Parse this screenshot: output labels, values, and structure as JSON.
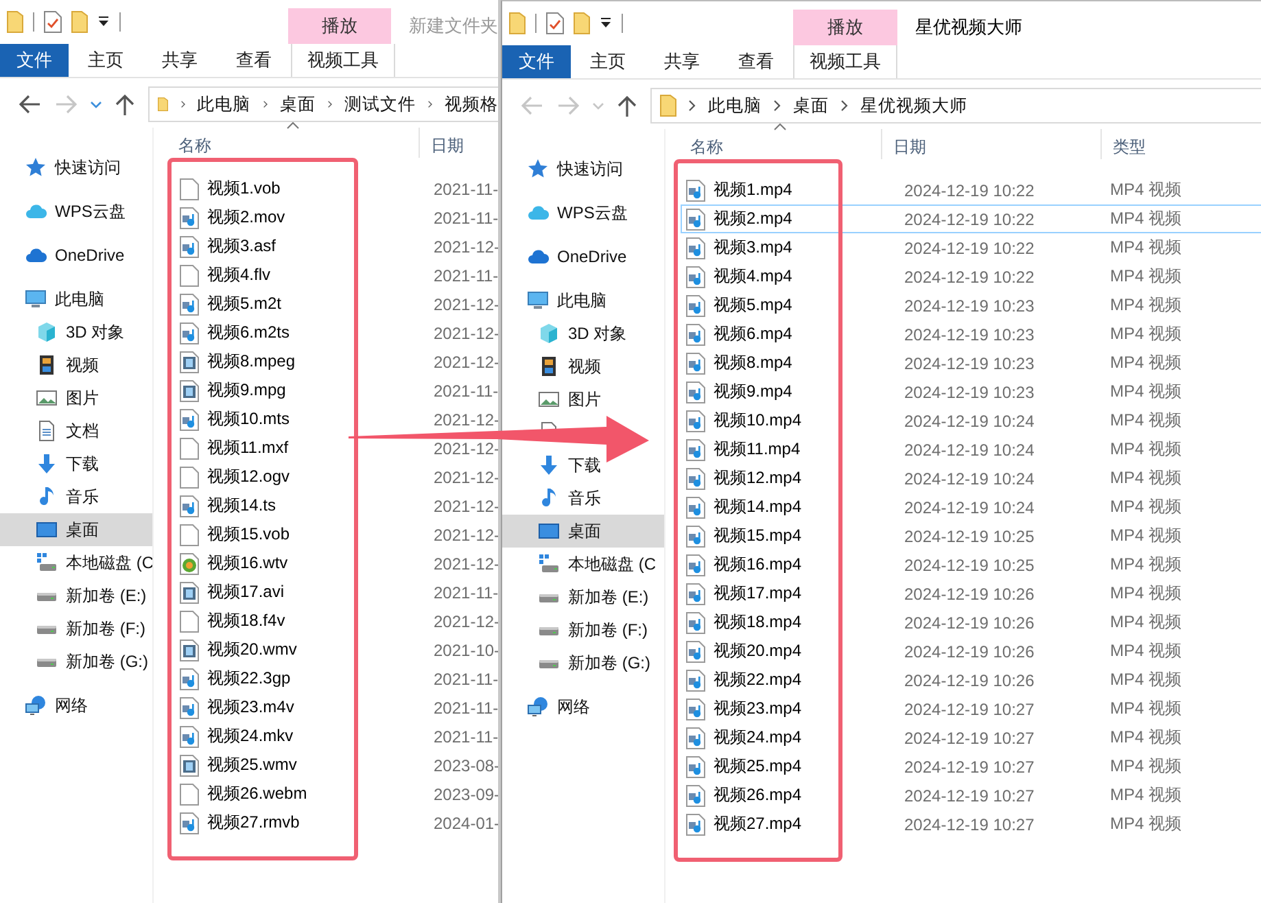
{
  "windows": [
    {
      "active": false,
      "contextual_header": "播放",
      "title": "新建文件夹",
      "tabs": [
        {
          "label": "文件",
          "kind": "file"
        },
        {
          "label": "主页",
          "kind": "normal"
        },
        {
          "label": "共享",
          "kind": "normal"
        },
        {
          "label": "查看",
          "kind": "normal"
        },
        {
          "label": "视频工具",
          "kind": "contextual"
        }
      ],
      "nav": [
        {
          "kind": "back",
          "disabled": false
        },
        {
          "kind": "forward",
          "disabled": true
        },
        {
          "kind": "recent",
          "disabled": false
        },
        {
          "kind": "up",
          "disabled": false
        }
      ],
      "breadcrumb": [
        "此电脑",
        "桌面",
        "测试文件",
        "视频格"
      ],
      "sidebar": [
        {
          "label": "快速访问",
          "kind": "star",
          "selected": false
        },
        {
          "label": "WPS云盘",
          "kind": "wps",
          "selected": false
        },
        {
          "label": "OneDrive",
          "kind": "onedrive",
          "selected": false
        },
        {
          "label": "此电脑",
          "kind": "pc",
          "selected": false,
          "children": [
            {
              "label": "3D 对象",
              "kind": "cube",
              "selected": false
            },
            {
              "label": "视频",
              "kind": "film",
              "selected": false
            },
            {
              "label": "图片",
              "kind": "picture",
              "selected": false
            },
            {
              "label": "文档",
              "kind": "document",
              "selected": false
            },
            {
              "label": "下载",
              "kind": "download",
              "selected": false
            },
            {
              "label": "音乐",
              "kind": "music",
              "selected": false
            },
            {
              "label": "桌面",
              "kind": "desktop",
              "selected": true
            },
            {
              "label": "本地磁盘 (C",
              "kind": "system-drive",
              "selected": false
            },
            {
              "label": "新加卷 (E:)",
              "kind": "drive",
              "selected": false
            },
            {
              "label": "新加卷 (F:)",
              "kind": "drive",
              "selected": false
            },
            {
              "label": "新加卷 (G:)",
              "kind": "drive",
              "selected": false
            }
          ]
        },
        {
          "label": "网络",
          "kind": "network",
          "selected": false
        }
      ],
      "columns": [
        "名称",
        "日期"
      ],
      "rows": [
        {
          "name": "视频1.vob",
          "kind": "blank",
          "date": "2021-11-",
          "selected": false
        },
        {
          "name": "视频2.mov",
          "kind": "media",
          "date": "2021-11-",
          "selected": false
        },
        {
          "name": "视频3.asf",
          "kind": "media",
          "date": "2021-12-",
          "selected": false
        },
        {
          "name": "视频4.flv",
          "kind": "blank",
          "date": "2021-11-",
          "selected": false
        },
        {
          "name": "视频5.m2t",
          "kind": "media",
          "date": "2021-12-",
          "selected": false
        },
        {
          "name": "视频6.m2ts",
          "kind": "media",
          "date": "2021-12-",
          "selected": false
        },
        {
          "name": "视频8.mpeg",
          "kind": "film",
          "date": "2021-12-",
          "selected": false
        },
        {
          "name": "视频9.mpg",
          "kind": "film",
          "date": "2021-11-",
          "selected": false
        },
        {
          "name": "视频10.mts",
          "kind": "media",
          "date": "2021-12-",
          "selected": false
        },
        {
          "name": "视频11.mxf",
          "kind": "blank",
          "date": "2021-12-",
          "selected": false
        },
        {
          "name": "视频12.ogv",
          "kind": "blank",
          "date": "2021-12-",
          "selected": false
        },
        {
          "name": "视频14.ts",
          "kind": "media",
          "date": "2021-12-",
          "selected": false
        },
        {
          "name": "视频15.vob",
          "kind": "blank",
          "date": "2021-12-",
          "selected": false
        },
        {
          "name": "视频16.wtv",
          "kind": "player",
          "date": "2021-12-",
          "selected": false
        },
        {
          "name": "视频17.avi",
          "kind": "film",
          "date": "2021-11-",
          "selected": false
        },
        {
          "name": "视频18.f4v",
          "kind": "blank",
          "date": "2021-12-",
          "selected": false
        },
        {
          "name": "视频20.wmv",
          "kind": "film",
          "date": "2021-10-",
          "selected": false
        },
        {
          "name": "视频22.3gp",
          "kind": "media",
          "date": "2021-11-",
          "selected": false
        },
        {
          "name": "视频23.m4v",
          "kind": "media",
          "date": "2021-11-",
          "selected": false
        },
        {
          "name": "视频24.mkv",
          "kind": "media",
          "date": "2021-11-",
          "selected": false
        },
        {
          "name": "视频25.wmv",
          "kind": "film",
          "date": "2023-08-",
          "selected": false
        },
        {
          "name": "视频26.webm",
          "kind": "blank",
          "date": "2023-09-",
          "selected": false
        },
        {
          "name": "视频27.rmvb",
          "kind": "media",
          "date": "2024-01-",
          "selected": false
        }
      ]
    },
    {
      "active": true,
      "contextual_header": "播放",
      "title": "星优视频大师",
      "tabs": [
        {
          "label": "文件",
          "kind": "file"
        },
        {
          "label": "主页",
          "kind": "normal"
        },
        {
          "label": "共享",
          "kind": "normal"
        },
        {
          "label": "查看",
          "kind": "normal"
        },
        {
          "label": "视频工具",
          "kind": "contextual"
        }
      ],
      "nav": [
        {
          "kind": "back",
          "disabled": true
        },
        {
          "kind": "forward",
          "disabled": true
        },
        {
          "kind": "recent",
          "disabled": true
        },
        {
          "kind": "up",
          "disabled": false
        }
      ],
      "breadcrumb": [
        "此电脑",
        "桌面",
        "星优视频大师"
      ],
      "sidebar": [
        {
          "label": "快速访问",
          "kind": "star",
          "selected": false
        },
        {
          "label": "WPS云盘",
          "kind": "wps",
          "selected": false
        },
        {
          "label": "OneDrive",
          "kind": "onedrive",
          "selected": false
        },
        {
          "label": "此电脑",
          "kind": "pc",
          "selected": false,
          "children": [
            {
              "label": "3D 对象",
              "kind": "cube",
              "selected": false
            },
            {
              "label": "视频",
              "kind": "film",
              "selected": false
            },
            {
              "label": "图片",
              "kind": "picture",
              "selected": false
            },
            {
              "kind": "document",
              "selected": false
            },
            {
              "label": "下载",
              "kind": "download",
              "selected": false
            },
            {
              "label": "音乐",
              "kind": "music",
              "selected": false
            },
            {
              "label": "桌面",
              "kind": "desktop",
              "selected": true
            },
            {
              "label": "本地磁盘 (C",
              "kind": "system-drive",
              "selected": false
            },
            {
              "label": "新加卷 (E:)",
              "kind": "drive",
              "selected": false
            },
            {
              "label": "新加卷 (F:)",
              "kind": "drive",
              "selected": false
            },
            {
              "label": "新加卷 (G:)",
              "kind": "drive",
              "selected": false
            }
          ]
        },
        {
          "label": "网络",
          "kind": "network",
          "selected": false
        }
      ],
      "columns": [
        "名称",
        "日期",
        "类型"
      ],
      "rows": [
        {
          "name": "视频1.mp4",
          "kind": "media",
          "date": "2024-12-19 10:22",
          "type": "MP4 视频",
          "selected": false
        },
        {
          "name": "视频2.mp4",
          "kind": "media",
          "date": "2024-12-19 10:22",
          "type": "MP4 视频",
          "selected": true
        },
        {
          "name": "视频3.mp4",
          "kind": "media",
          "date": "2024-12-19 10:22",
          "type": "MP4 视频",
          "selected": false
        },
        {
          "name": "视频4.mp4",
          "kind": "media",
          "date": "2024-12-19 10:22",
          "type": "MP4 视频",
          "selected": false
        },
        {
          "name": "视频5.mp4",
          "kind": "media",
          "date": "2024-12-19 10:23",
          "type": "MP4 视频",
          "selected": false
        },
        {
          "name": "视频6.mp4",
          "kind": "media",
          "date": "2024-12-19 10:23",
          "type": "MP4 视频",
          "selected": false
        },
        {
          "name": "视频8.mp4",
          "kind": "media",
          "date": "2024-12-19 10:23",
          "type": "MP4 视频",
          "selected": false
        },
        {
          "name": "视频9.mp4",
          "kind": "media",
          "date": "2024-12-19 10:23",
          "type": "MP4 视频",
          "selected": false
        },
        {
          "name": "视频10.mp4",
          "kind": "media",
          "date": "2024-12-19 10:24",
          "type": "MP4 视频",
          "selected": false
        },
        {
          "name": "视频11.mp4",
          "kind": "media",
          "date": "2024-12-19 10:24",
          "type": "MP4 视频",
          "selected": false
        },
        {
          "name": "视频12.mp4",
          "kind": "media",
          "date": "2024-12-19 10:24",
          "type": "MP4 视频",
          "selected": false
        },
        {
          "name": "视频14.mp4",
          "kind": "media",
          "date": "2024-12-19 10:24",
          "type": "MP4 视频",
          "selected": false
        },
        {
          "name": "视频15.mp4",
          "kind": "media",
          "date": "2024-12-19 10:25",
          "type": "MP4 视频",
          "selected": false
        },
        {
          "name": "视频16.mp4",
          "kind": "media",
          "date": "2024-12-19 10:25",
          "type": "MP4 视频",
          "selected": false
        },
        {
          "name": "视频17.mp4",
          "kind": "media",
          "date": "2024-12-19 10:26",
          "type": "MP4 视频",
          "selected": false
        },
        {
          "name": "视频18.mp4",
          "kind": "media",
          "date": "2024-12-19 10:26",
          "type": "MP4 视频",
          "selected": false
        },
        {
          "name": "视频20.mp4",
          "kind": "media",
          "date": "2024-12-19 10:26",
          "type": "MP4 视频",
          "selected": false
        },
        {
          "name": "视频22.mp4",
          "kind": "media",
          "date": "2024-12-19 10:26",
          "type": "MP4 视频",
          "selected": false
        },
        {
          "name": "视频23.mp4",
          "kind": "media",
          "date": "2024-12-19 10:27",
          "type": "MP4 视频",
          "selected": false
        },
        {
          "name": "视频24.mp4",
          "kind": "media",
          "date": "2024-12-19 10:27",
          "type": "MP4 视频",
          "selected": false
        },
        {
          "name": "视频25.mp4",
          "kind": "media",
          "date": "2024-12-19 10:27",
          "type": "MP4 视频",
          "selected": false
        },
        {
          "name": "视频26.mp4",
          "kind": "media",
          "date": "2024-12-19 10:27",
          "type": "MP4 视频",
          "selected": false
        },
        {
          "name": "视频27.mp4",
          "kind": "media",
          "date": "2024-12-19 10:27",
          "type": "MP4 视频",
          "selected": false
        }
      ]
    }
  ]
}
